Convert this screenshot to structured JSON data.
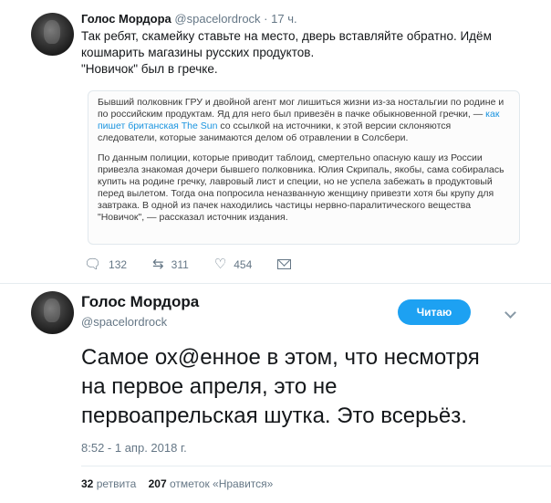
{
  "tweet1": {
    "name": "Голос Мордора",
    "handle": "@spacelordrock",
    "sep": "·",
    "time": "17 ч.",
    "line1": "Так ребят, скамейку ставьте на место, дверь вставляйте обратно. Идём",
    "line2": "кошмарить магазины русских продуктов.",
    "line3": "\"Новичок\" был в гречке.",
    "quote": {
      "p1_start": "Бывший полковник ГРУ и двойной агент мог лишиться жизни из-за ностальгии по родине и по российским продуктам. Яд для него был привезён в пачке обыкновенной гречки, —",
      "p1_link": "как пишет британская The Sun",
      "p1_end": "со ссылкой на источники, к этой версии склоняются следователи, которые занимаются делом об отравлении в Солсбери.",
      "p2": "По данным полиции, которые приводит таблоид, смертельно опасную кашу из России привезла знакомая дочери бывшего полковника. Юлия Скрипаль, якобы, сама собиралась купить на родине гречку, лавровый лист и специи, но не успела забежать в продуктовый перед вылетом. Тогда она попросила неназванную женщину привезти хотя бы крупу для завтрака. В одной из пачек находились частицы нервно-паралитического вещества \"Новичок\", — рассказал источник издания."
    },
    "replies": "132",
    "retweets": "311",
    "likes": "454"
  },
  "tweet2": {
    "name": "Голос Мордора",
    "handle": "@spacelordrock",
    "follow_label": "Читаю",
    "line1": "Самое ох@енное в этом, что несмотря",
    "line2": "на первое апреля, это не",
    "line3": "первоапрельская шутка. Это всерьёз.",
    "timestamp": "8:52 - 1 апр. 2018 г.",
    "retweet_count": "32",
    "retweet_label": "ретвита",
    "like_count": "207",
    "like_label": "отметок «Нравится»"
  },
  "icons": [
    "reply-icon",
    "retweet-icon",
    "like-icon",
    "message-icon",
    "chevron-down-icon"
  ],
  "colors": {
    "accent": "#1da1f2",
    "link": "#1b95e0",
    "muted": "#657786"
  }
}
